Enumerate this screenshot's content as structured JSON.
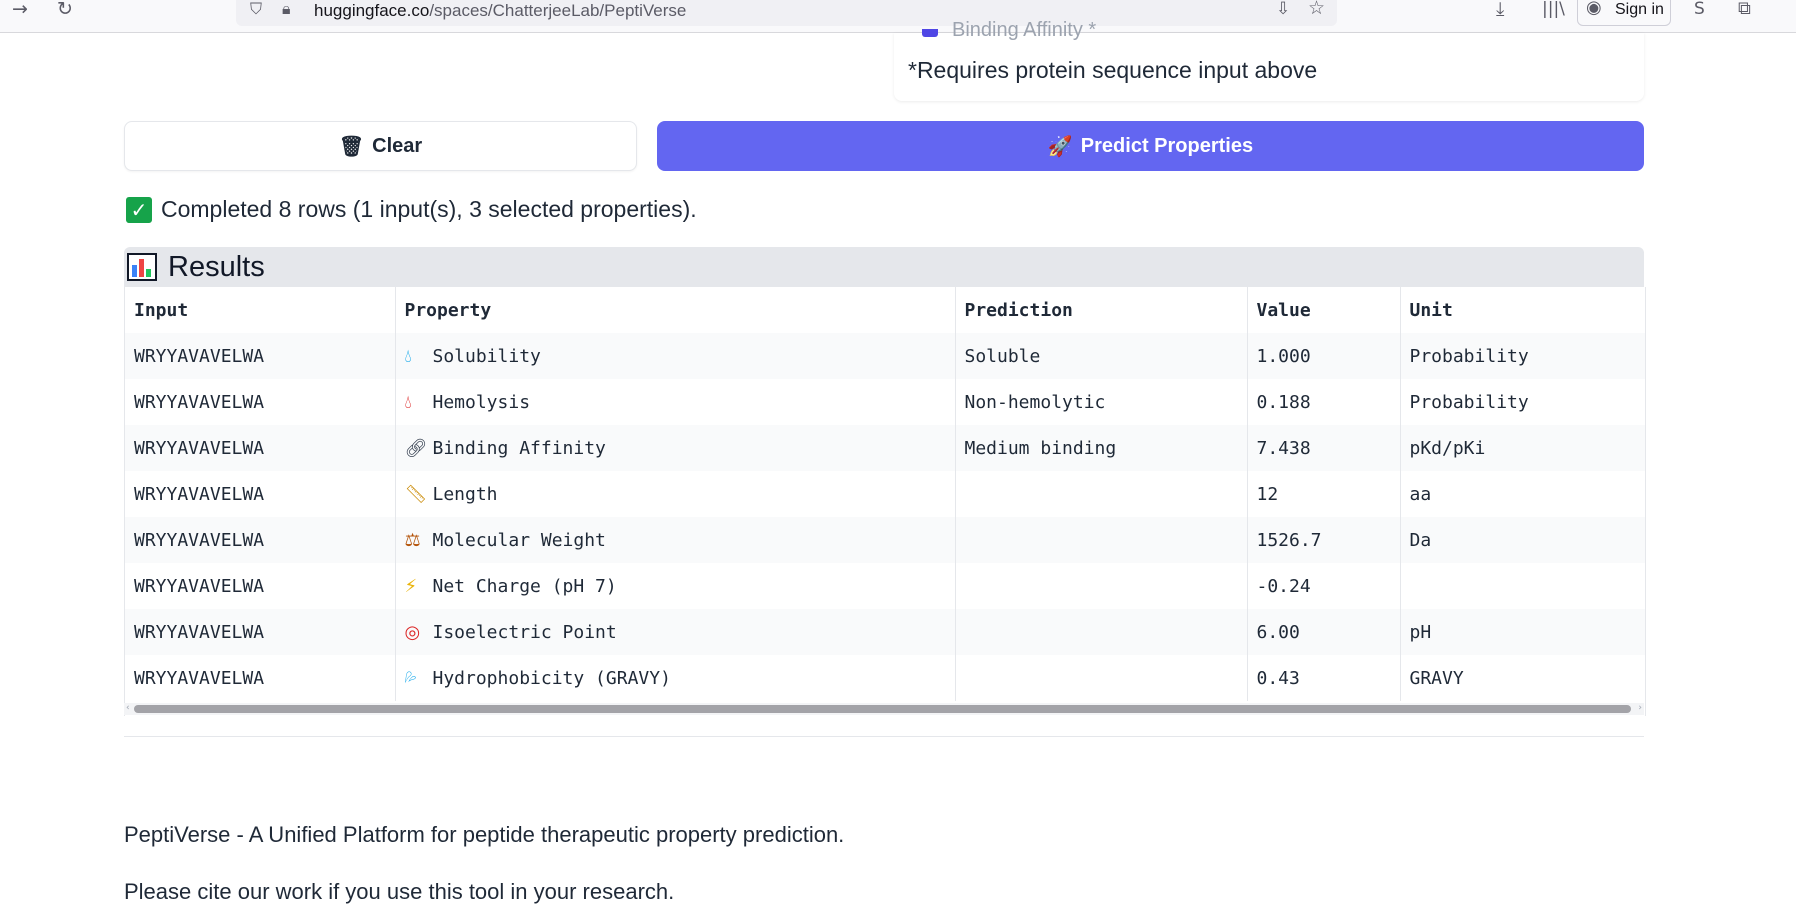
{
  "browser": {
    "url_host": "huggingface.co",
    "url_path": "/spaces/ChatterjeeLab/PeptiVerse",
    "signin_label": "Sign in"
  },
  "top_card": {
    "partial_label": "Binding Affinity *",
    "requires_note": "*Requires protein sequence input above"
  },
  "buttons": {
    "clear_label": "Clear",
    "clear_icon": "trash-icon",
    "predict_label": "Predict Properties",
    "predict_icon": "rocket-icon"
  },
  "status": {
    "text": "Completed 8 rows (1 input(s), 3 selected properties).",
    "icon": "check-mark-icon"
  },
  "results": {
    "title": "Results",
    "icon": "bar-chart-icon",
    "columns": [
      "Input",
      "Property",
      "Prediction",
      "Value",
      "Unit"
    ],
    "rows": [
      {
        "input": "WRYYAVAVELWA",
        "icon": "droplet-icon",
        "property": "Solubility",
        "prediction": "Soluble",
        "value": "1.000",
        "unit": "Probability"
      },
      {
        "input": "WRYYAVAVELWA",
        "icon": "blood-drop-icon",
        "property": "Hemolysis",
        "prediction": "Non-hemolytic",
        "value": "0.188",
        "unit": "Probability"
      },
      {
        "input": "WRYYAVAVELWA",
        "icon": "link-icon",
        "property": "Binding Affinity",
        "prediction": "Medium binding",
        "value": "7.438",
        "unit": "pKd/pKi"
      },
      {
        "input": "WRYYAVAVELWA",
        "icon": "ruler-icon",
        "property": "Length",
        "prediction": "",
        "value": "12",
        "unit": "aa"
      },
      {
        "input": "WRYYAVAVELWA",
        "icon": "scales-icon",
        "property": "Molecular Weight",
        "prediction": "",
        "value": "1526.7",
        "unit": "Da"
      },
      {
        "input": "WRYYAVAVELWA",
        "icon": "lightning-icon",
        "property": "Net Charge (pH 7)",
        "prediction": "",
        "value": "-0.24",
        "unit": ""
      },
      {
        "input": "WRYYAVAVELWA",
        "icon": "target-icon",
        "property": "Isoelectric Point",
        "prediction": "",
        "value": "6.00",
        "unit": "pH"
      },
      {
        "input": "WRYYAVAVELWA",
        "icon": "droplets-icon",
        "property": "Hydrophobicity (GRAVY)",
        "prediction": "",
        "value": "0.43",
        "unit": "GRAVY"
      }
    ]
  },
  "footer": {
    "line1": "PeptiVerse - A Unified Platform for peptide therapeutic property prediction.",
    "line2": "Please cite our work if you use this tool in your research."
  },
  "colors": {
    "accent": "#6366f1",
    "success": "#16a34a"
  }
}
